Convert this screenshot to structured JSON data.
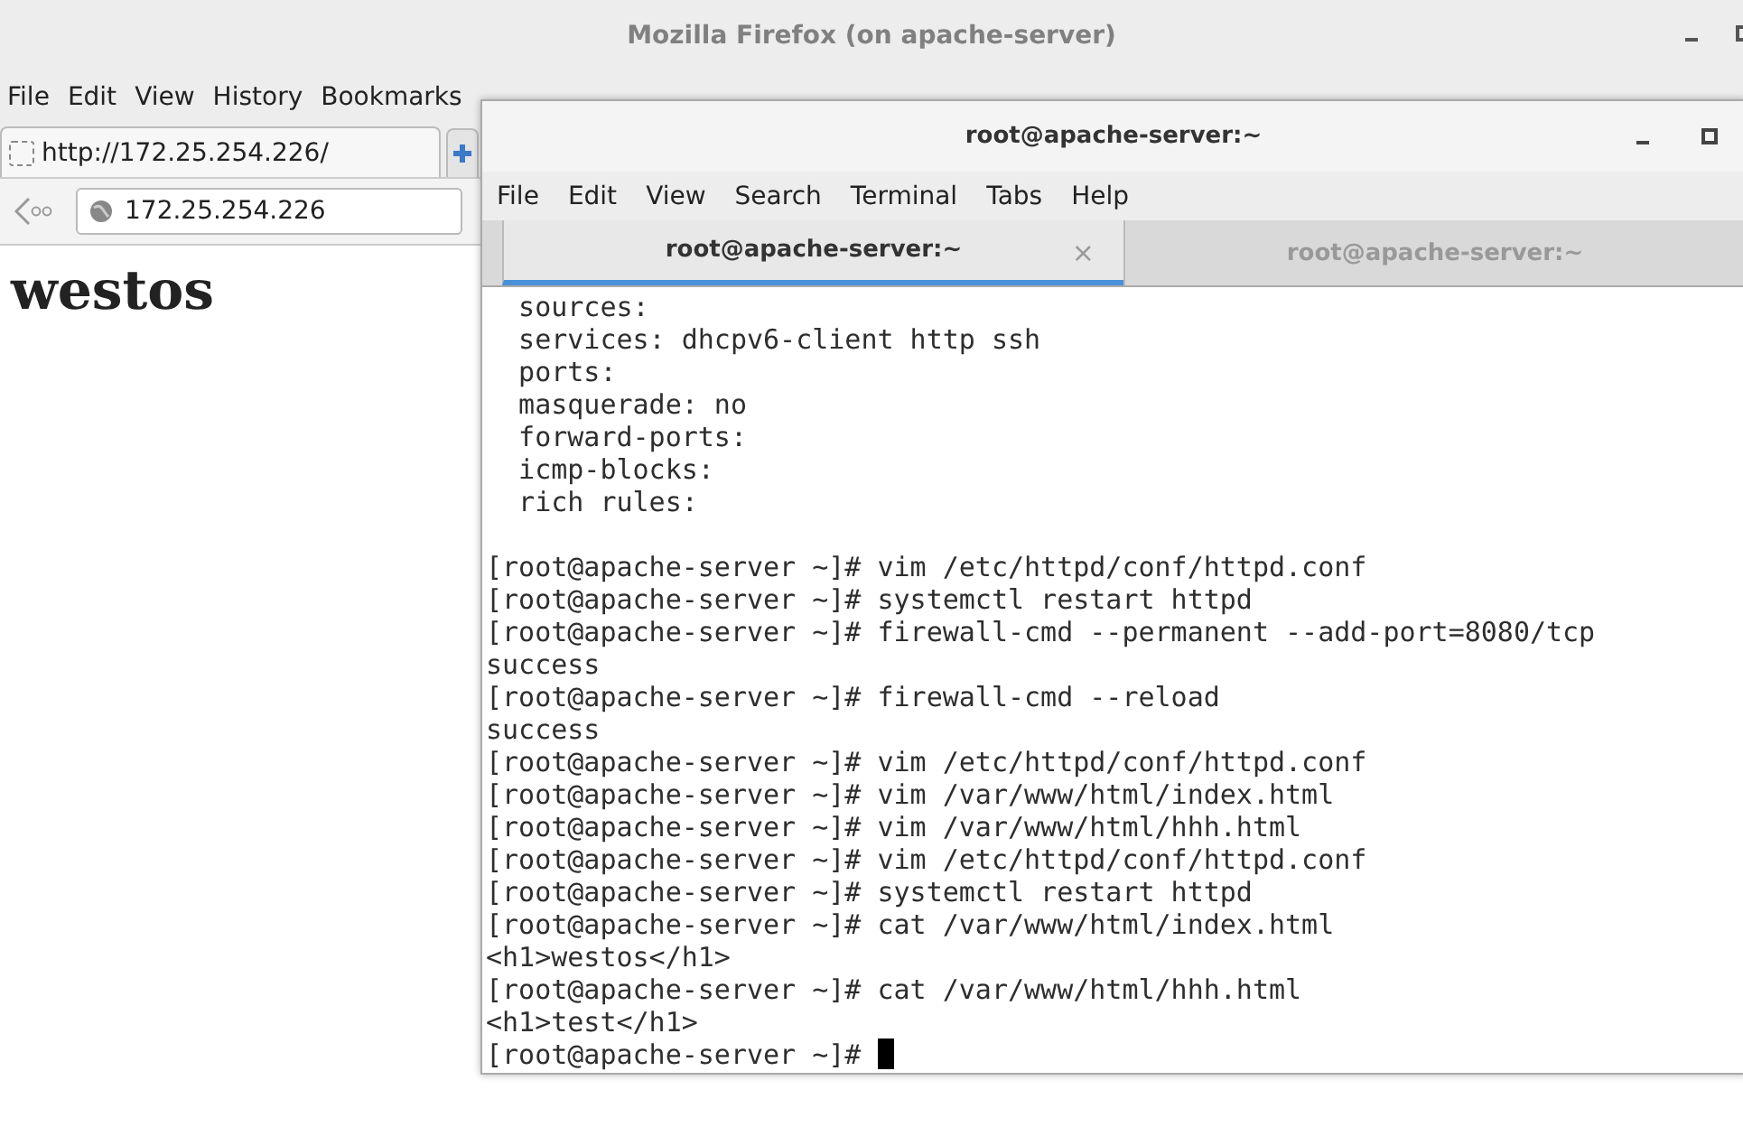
{
  "firefox": {
    "title": "Mozilla Firefox (on apache-server)",
    "menu": [
      "File",
      "Edit",
      "View",
      "History",
      "Bookmarks"
    ],
    "tabs": [
      {
        "label": "http://172.25.254.226/",
        "selected": true
      }
    ],
    "url": "172.25.254.226",
    "page_heading": "westos"
  },
  "terminal": {
    "title": "root@apache-server:~",
    "menu": [
      "File",
      "Edit",
      "View",
      "Search",
      "Terminal",
      "Tabs",
      "Help"
    ],
    "tabs": [
      {
        "label": "root@apache-server:~",
        "selected": true,
        "close": "×"
      },
      {
        "label": "root@apache-server:~",
        "selected": false
      }
    ],
    "blocks": [
      {
        "lines": [
          "  sources:",
          "  services: dhcpv6-client http ssh",
          "  ports:",
          "  masquerade: no",
          "  forward-ports:",
          "  icmp-blocks:",
          "  rich rules:"
        ]
      },
      {
        "lines": [
          "[root@apache-server ~]# vim /etc/httpd/conf/httpd.conf",
          "[root@apache-server ~]# systemctl restart httpd",
          "[root@apache-server ~]# firewall-cmd --permanent --add-port=8080/tcp",
          "success",
          "[root@apache-server ~]# firewall-cmd --reload",
          "success",
          "[root@apache-server ~]# vim /etc/httpd/conf/httpd.conf",
          "[root@apache-server ~]# vim /var/www/html/index.html",
          "[root@apache-server ~]# vim /var/www/html/hhh.html",
          "[root@apache-server ~]# vim /etc/httpd/conf/httpd.conf",
          "[root@apache-server ~]# systemctl restart httpd",
          "[root@apache-server ~]# cat /var/www/html/index.html",
          "<h1>westos</h1>",
          "[root@apache-server ~]# cat /var/www/html/hhh.html",
          "<h1>test</h1>",
          "[root@apache-server ~]# "
        ]
      }
    ]
  }
}
